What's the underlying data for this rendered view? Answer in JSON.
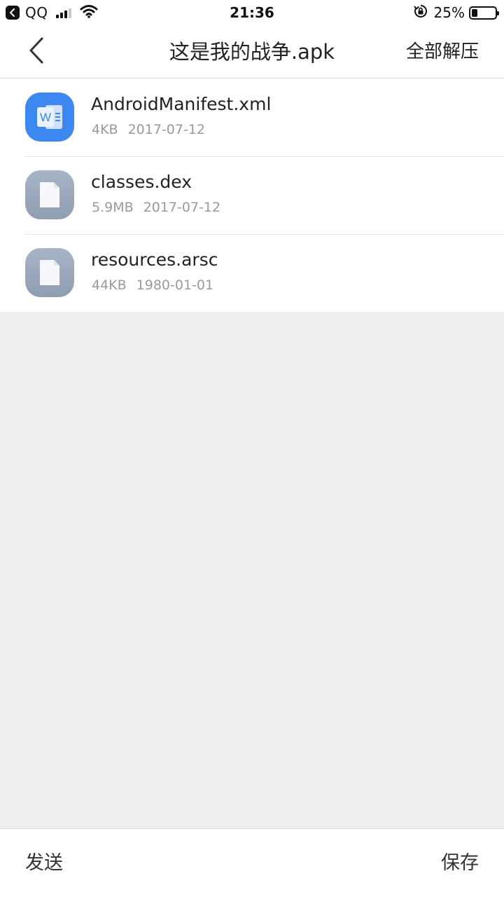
{
  "status_bar": {
    "carrier": "QQ",
    "time": "21:36",
    "battery_text": "25%",
    "battery_level": 0.25,
    "signal_bars_active": 3,
    "signal_bars_total": 4
  },
  "nav": {
    "title": "这是我的战争.apk",
    "action_label": "全部解压"
  },
  "files": [
    {
      "name": "AndroidManifest.xml",
      "size": "4KB",
      "date": "2017-07-12",
      "icon": "word-doc-icon"
    },
    {
      "name": "classes.dex",
      "size": "5.9MB",
      "date": "2017-07-12",
      "icon": "file-icon"
    },
    {
      "name": "resources.arsc",
      "size": "44KB",
      "date": "1980-01-01",
      "icon": "file-icon"
    }
  ],
  "bottom_bar": {
    "send_label": "发送",
    "save_label": "保存"
  },
  "colors": {
    "word_icon": "#3d87f0",
    "generic_icon": "#98a5b9",
    "background": "#efefef"
  }
}
